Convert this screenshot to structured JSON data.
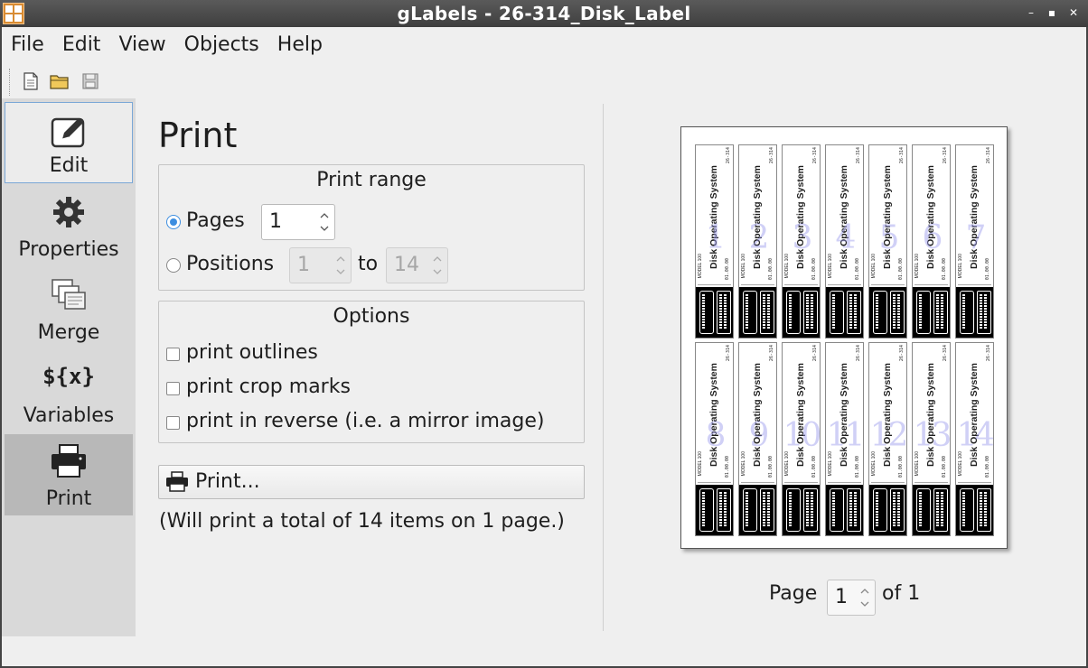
{
  "window": {
    "title": "gLabels - 26-314_Disk_Label"
  },
  "menu": [
    "File",
    "Edit",
    "View",
    "Objects",
    "Help"
  ],
  "toolbar": {
    "icons": [
      "new-document-icon",
      "open-folder-icon",
      "save-icon"
    ]
  },
  "sidebar": {
    "items": [
      {
        "label": "Edit",
        "icon": "edit-icon"
      },
      {
        "label": "Properties",
        "icon": "gear-icon"
      },
      {
        "label": "Merge",
        "icon": "merge-icon"
      },
      {
        "label": "Variables",
        "icon": "${x}"
      },
      {
        "label": "Print",
        "icon": "printer-icon"
      }
    ]
  },
  "print": {
    "heading": "Print",
    "range": {
      "title": "Print range",
      "pages_label": "Pages",
      "pages_value": "1",
      "positions_label": "Positions",
      "from_value": "1",
      "to_label": "to",
      "to_value": "14"
    },
    "options": {
      "title": "Options",
      "print_outlines": "print outlines",
      "print_crop_marks": "print crop marks",
      "print_reverse": "print in reverse (i.e. a mirror image)"
    },
    "print_button": "Print...",
    "summary": "(Will print a total of 14 items on 1 page.)"
  },
  "preview": {
    "label_text": "Disk Operating System",
    "label_code": "26-314",
    "model_text": "MODEL 100",
    "version_text": "01.00.00",
    "row1_numbers": [
      "1",
      "2",
      "3",
      "4",
      "5",
      "6",
      "7"
    ],
    "row2_numbers": [
      "8",
      "9",
      "10",
      "11",
      "12",
      "13",
      "14"
    ]
  },
  "pager": {
    "page_label": "Page",
    "page_value": "1",
    "of_label": "of 1"
  }
}
